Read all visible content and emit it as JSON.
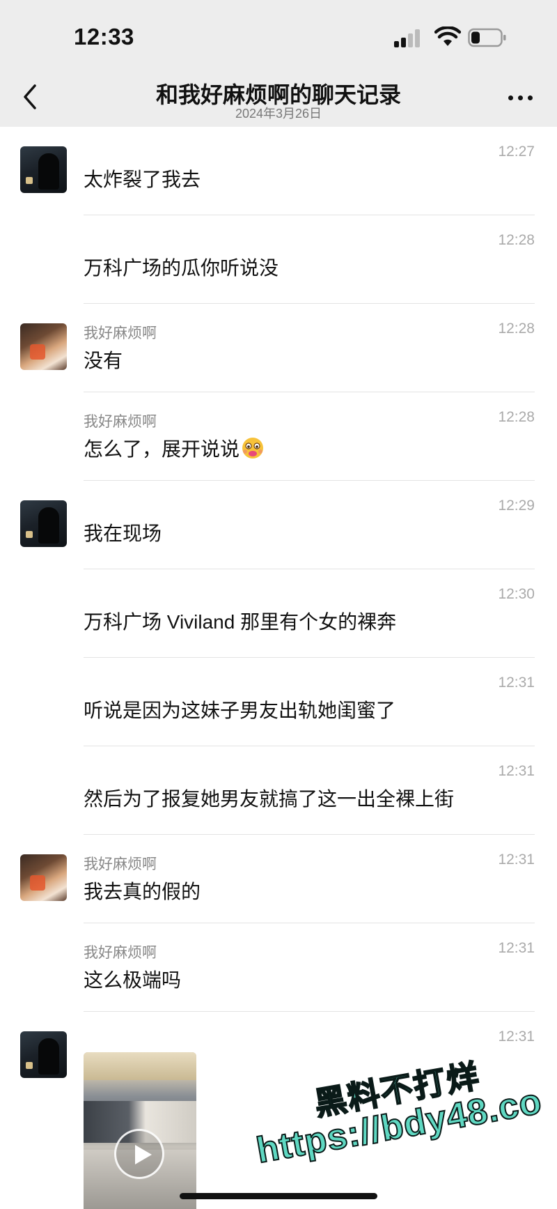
{
  "status_bar": {
    "time": "12:33"
  },
  "header": {
    "title": "和我好麻烦啊的聊天记录",
    "date": "2024年3月26日"
  },
  "messages": [
    {
      "sender": "",
      "time": "12:27",
      "text": "太炸裂了我去",
      "avatar": "dark-avatar"
    },
    {
      "sender": "",
      "time": "12:28",
      "text": "万科广场的瓜你听说没",
      "avatar": ""
    },
    {
      "sender": "我好麻烦啊",
      "time": "12:28",
      "text": "没有",
      "avatar": "warm-avatar"
    },
    {
      "sender": "我好麻烦啊",
      "time": "12:28",
      "text": "怎么了，展开说说",
      "avatar": "",
      "emoji": "shy-face-emoji"
    },
    {
      "sender": "",
      "time": "12:29",
      "text": "我在现场",
      "avatar": "dark-avatar"
    },
    {
      "sender": "",
      "time": "12:30",
      "text": "万科广场 Viviland 那里有个女的裸奔",
      "avatar": ""
    },
    {
      "sender": "",
      "time": "12:31",
      "text": "听说是因为这妹子男友出轨她闺蜜了",
      "avatar": ""
    },
    {
      "sender": "",
      "time": "12:31",
      "text": "然后为了报复她男友就搞了这一出全裸上街",
      "avatar": ""
    },
    {
      "sender": "我好麻烦啊",
      "time": "12:31",
      "text": "我去真的假的",
      "avatar": "warm-avatar"
    },
    {
      "sender": "我好麻烦啊",
      "time": "12:31",
      "text": "这么极端吗",
      "avatar": ""
    },
    {
      "sender": "",
      "time": "12:31",
      "text": "",
      "avatar": "dark-avatar",
      "media": "video"
    }
  ],
  "watermark": {
    "line1": "黑料不打烊",
    "line2": "https://bdy48.co"
  },
  "colors": {
    "header_bg": "#ededed",
    "watermark": "#5fd8c2"
  }
}
